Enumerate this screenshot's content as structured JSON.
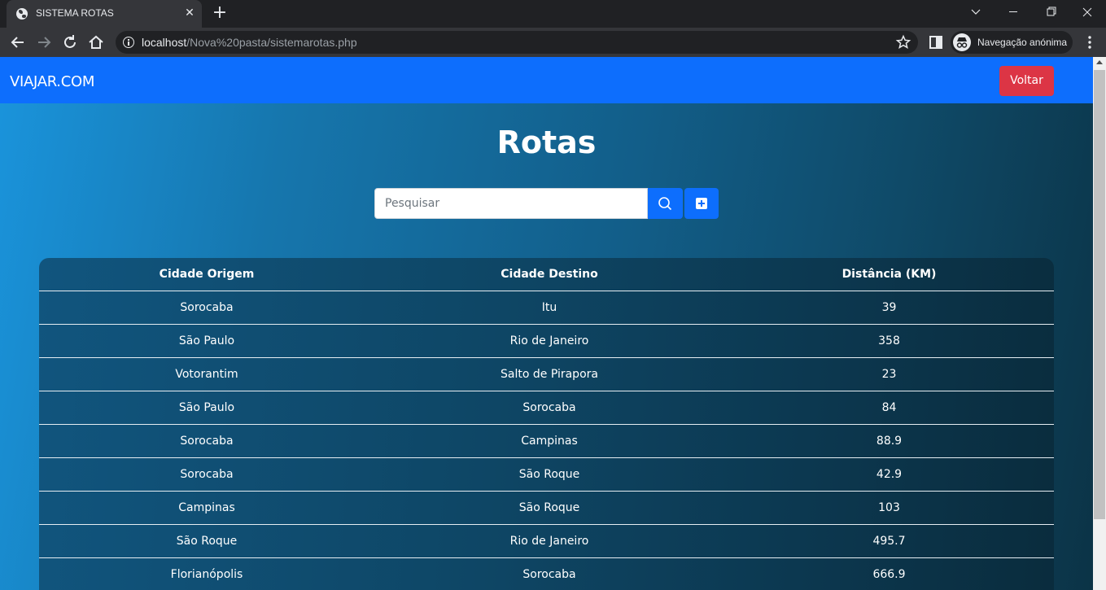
{
  "browser": {
    "tab_title": "SISTEMA ROTAS",
    "url_host": "localhost",
    "url_path": "/Nova%20pasta/sistemarotas.php",
    "incognito_label": "Navegação anónima"
  },
  "navbar": {
    "brand": "VIAJAR.COM",
    "back_label": "Voltar"
  },
  "page": {
    "title": "Rotas"
  },
  "search": {
    "placeholder": "Pesquisar"
  },
  "colors": {
    "navbar": "#0d6efd",
    "back_button": "#dc3545",
    "buttons": "#0d6efd"
  },
  "table": {
    "headers": [
      "Cidade Origem",
      "Cidade Destino",
      "Distância (KM)"
    ],
    "rows": [
      [
        "Sorocaba",
        "Itu",
        "39"
      ],
      [
        "São Paulo",
        "Rio de Janeiro",
        "358"
      ],
      [
        "Votorantim",
        "Salto de Pirapora",
        "23"
      ],
      [
        "São Paulo",
        "Sorocaba",
        "84"
      ],
      [
        "Sorocaba",
        "Campinas",
        "88.9"
      ],
      [
        "Sorocaba",
        "São Roque",
        "42.9"
      ],
      [
        "Campinas",
        "São Roque",
        "103"
      ],
      [
        "São Roque",
        "Rio de Janeiro",
        "495.7"
      ],
      [
        "Florianópolis",
        "Sorocaba",
        "666.9"
      ]
    ]
  }
}
